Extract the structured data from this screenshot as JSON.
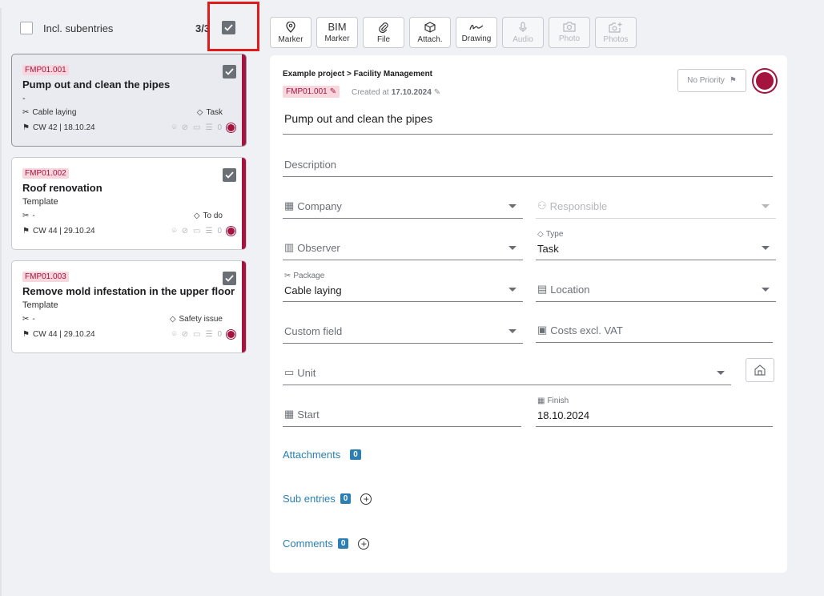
{
  "list": {
    "incl_subentries_label": "Incl. subentries",
    "count": "3/3",
    "cards": [
      {
        "code": "FMP01.001",
        "title": "Pump out and clean the pipes",
        "subtitle": "-",
        "package": "Cable laying",
        "type": "Task",
        "week": "CW 42 | 18.10.24",
        "comments": "0"
      },
      {
        "code": "FMP01.002",
        "title": "Roof renovation",
        "subtitle": "Template",
        "package": "-",
        "type": "To do",
        "week": "CW 44 | 29.10.24",
        "comments": "0"
      },
      {
        "code": "FMP01.003",
        "title": "Remove mold infestation in the upper floor",
        "subtitle": "Template",
        "package": "-",
        "type": "Safety issue",
        "week": "CW 44 | 29.10.24",
        "comments": "0"
      }
    ]
  },
  "toolbar": {
    "marker": "Marker",
    "bim_top": "BIM",
    "bim_bottom": "Marker",
    "file": "File",
    "attach": "Attach.",
    "drawing": "Drawing",
    "audio": "Audio",
    "photo": "Photo",
    "photos": "Photos"
  },
  "detail": {
    "breadcrumb": "Example project > Facility Management",
    "code": "FMP01.001",
    "created_label": "Created at",
    "created_date": "17.10.2024",
    "priority": "No Priority",
    "title": "Pump out and clean the pipes",
    "description_placeholder": "Description",
    "company": "Company",
    "responsible": "Responsible",
    "observer": "Observer",
    "type_label": "Type",
    "type_value": "Task",
    "package_label": "Package",
    "package_value": "Cable laying",
    "location": "Location",
    "custom_field": "Custom field",
    "costs": "Costs excl. VAT",
    "unit": "Unit",
    "start": "Start",
    "finish_label": "Finish",
    "finish_value": "18.10.2024",
    "attachments": "Attachments",
    "attachments_count": "0",
    "sub_entries": "Sub entries",
    "sub_entries_count": "0",
    "comments": "Comments",
    "comments_count": "0"
  },
  "colors": {
    "accent": "#a5143f",
    "link": "#2b7fb3",
    "highlight": "#e01b1b"
  }
}
